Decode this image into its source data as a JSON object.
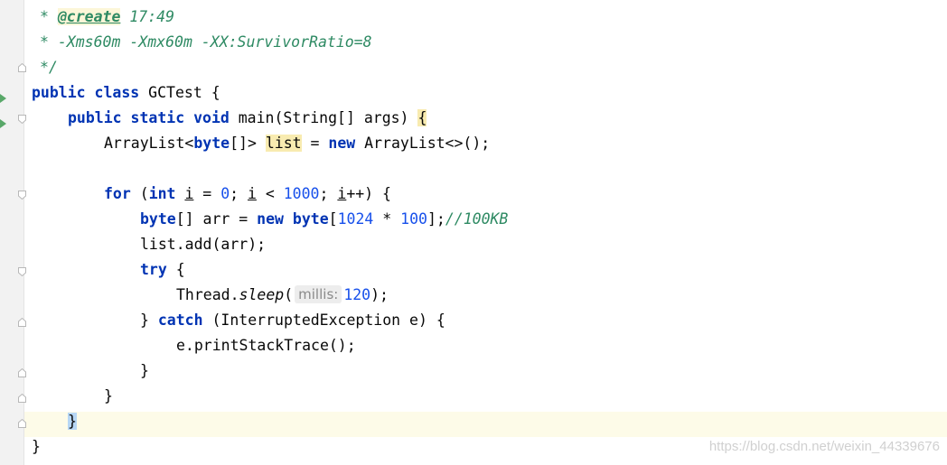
{
  "editor": {
    "comment": {
      "create_prefix": "* ",
      "create_tag": "@create",
      "create_time": " 17:49",
      "jvm_args": "* -Xms60m -Xmx60m -XX:SurvivorRatio=8",
      "close": "*/"
    },
    "code": {
      "class_kw": "public class",
      "class_name": " GCTest {",
      "main_kw": "public static void",
      "main_sig": " main(String[] args) ",
      "open_brace": "{",
      "list_type": "ArrayList<",
      "list_byte": "byte",
      "list_type_rest": "[]> ",
      "list_var": "list",
      "list_eq": " = ",
      "new_kw": "new",
      "list_ctor": " ArrayList<>();",
      "for_kw": "for",
      "for_paren": " (",
      "int_kw": "int",
      "for_i1": "i",
      "for_mid1": " = ",
      "zero": "0",
      "for_mid2": "; ",
      "for_i2": "i",
      "for_mid3": " < ",
      "thousand": "1000",
      "for_mid4": "; ",
      "for_i3": "i",
      "for_end": "++) {",
      "arr_byte": "byte",
      "arr_decl": "[] arr = ",
      "arr_new": "new",
      "arr_byte2": " byte",
      "arr_bracket": "[",
      "n1024": "1024",
      "mul": " * ",
      "n100": "100",
      "arr_end": "];",
      "arr_comment": "//100KB",
      "add_call": "list.add(arr);",
      "try_kw": "try",
      "try_brace": " {",
      "thread": "Thread.",
      "sleep": "sleep",
      "paren_open": "(",
      "hint_label": "millis:",
      "n120": "120",
      "sleep_end": ");",
      "catch_pre": "} ",
      "catch_kw": "catch",
      "catch_rest": " (InterruptedException e) {",
      "print_trace": "e.printStackTrace();",
      "close_brace": "}"
    },
    "watermark": "https://blog.csdn.net/weixin_44339676"
  }
}
